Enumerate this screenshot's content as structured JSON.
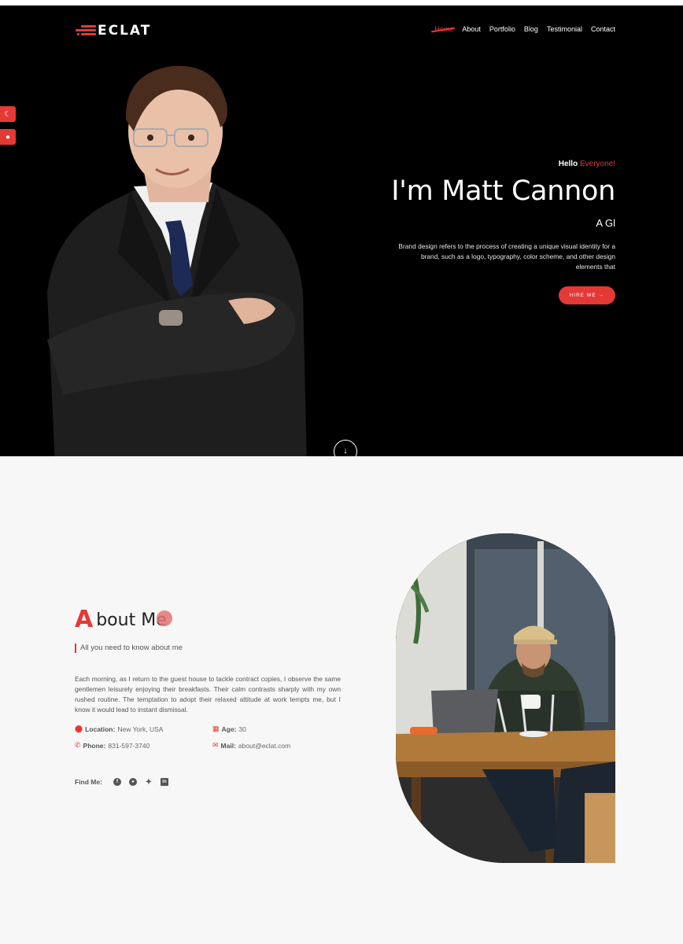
{
  "brand": {
    "name": "ECLAT"
  },
  "nav": {
    "items": [
      {
        "label": "Home",
        "active": true
      },
      {
        "label": "About"
      },
      {
        "label": "Portfolio"
      },
      {
        "label": "Blog"
      },
      {
        "label": "Testimonial"
      },
      {
        "label": "Contact"
      }
    ]
  },
  "side_buttons": [
    {
      "icon": "moon-icon",
      "glyph": "☾"
    },
    {
      "icon": "palette-icon",
      "glyph": "●"
    }
  ],
  "hero": {
    "greeting": "Hello",
    "greeting_accent": "Everyone!",
    "name": "I'm Matt Cannon",
    "role": "A Gl",
    "description": "Brand design refers to the process of creating a unique visual identity for a brand, such as a logo, typography, color scheme, and other design elements that",
    "cta": "HIRE ME →",
    "scroll_icon": "arrow-down-icon",
    "scroll_glyph": "↓"
  },
  "about": {
    "title_first": "A",
    "title_rest": "bout Me",
    "subtitle": "All you need to know about me",
    "paragraph": "Each morning, as I return to the guest house to tackle contract copies, I observe the same gentlemen leisurely enjoying their breakfasts. Their calm contrasts sharply with my own rushed routine. The temptation to adopt their relaxed attitude at work tempts me, but I know it would lead to instant dismissal.",
    "info": {
      "location_label": "Location:",
      "location_value": "New York, USA",
      "age_label": "Age:",
      "age_value": "30",
      "phone_label": "Phone:",
      "phone_value": "831-597-3740",
      "mail_label": "Mail:",
      "mail_value": "about@eclat.com"
    },
    "find_me_label": "Find Me:",
    "socials": [
      "facebook-icon",
      "github-icon",
      "twitter-icon",
      "linkedin-icon"
    ]
  },
  "colors": {
    "accent": "#e53935",
    "hero_bg": "#000000",
    "about_bg": "#f7f7f7"
  }
}
